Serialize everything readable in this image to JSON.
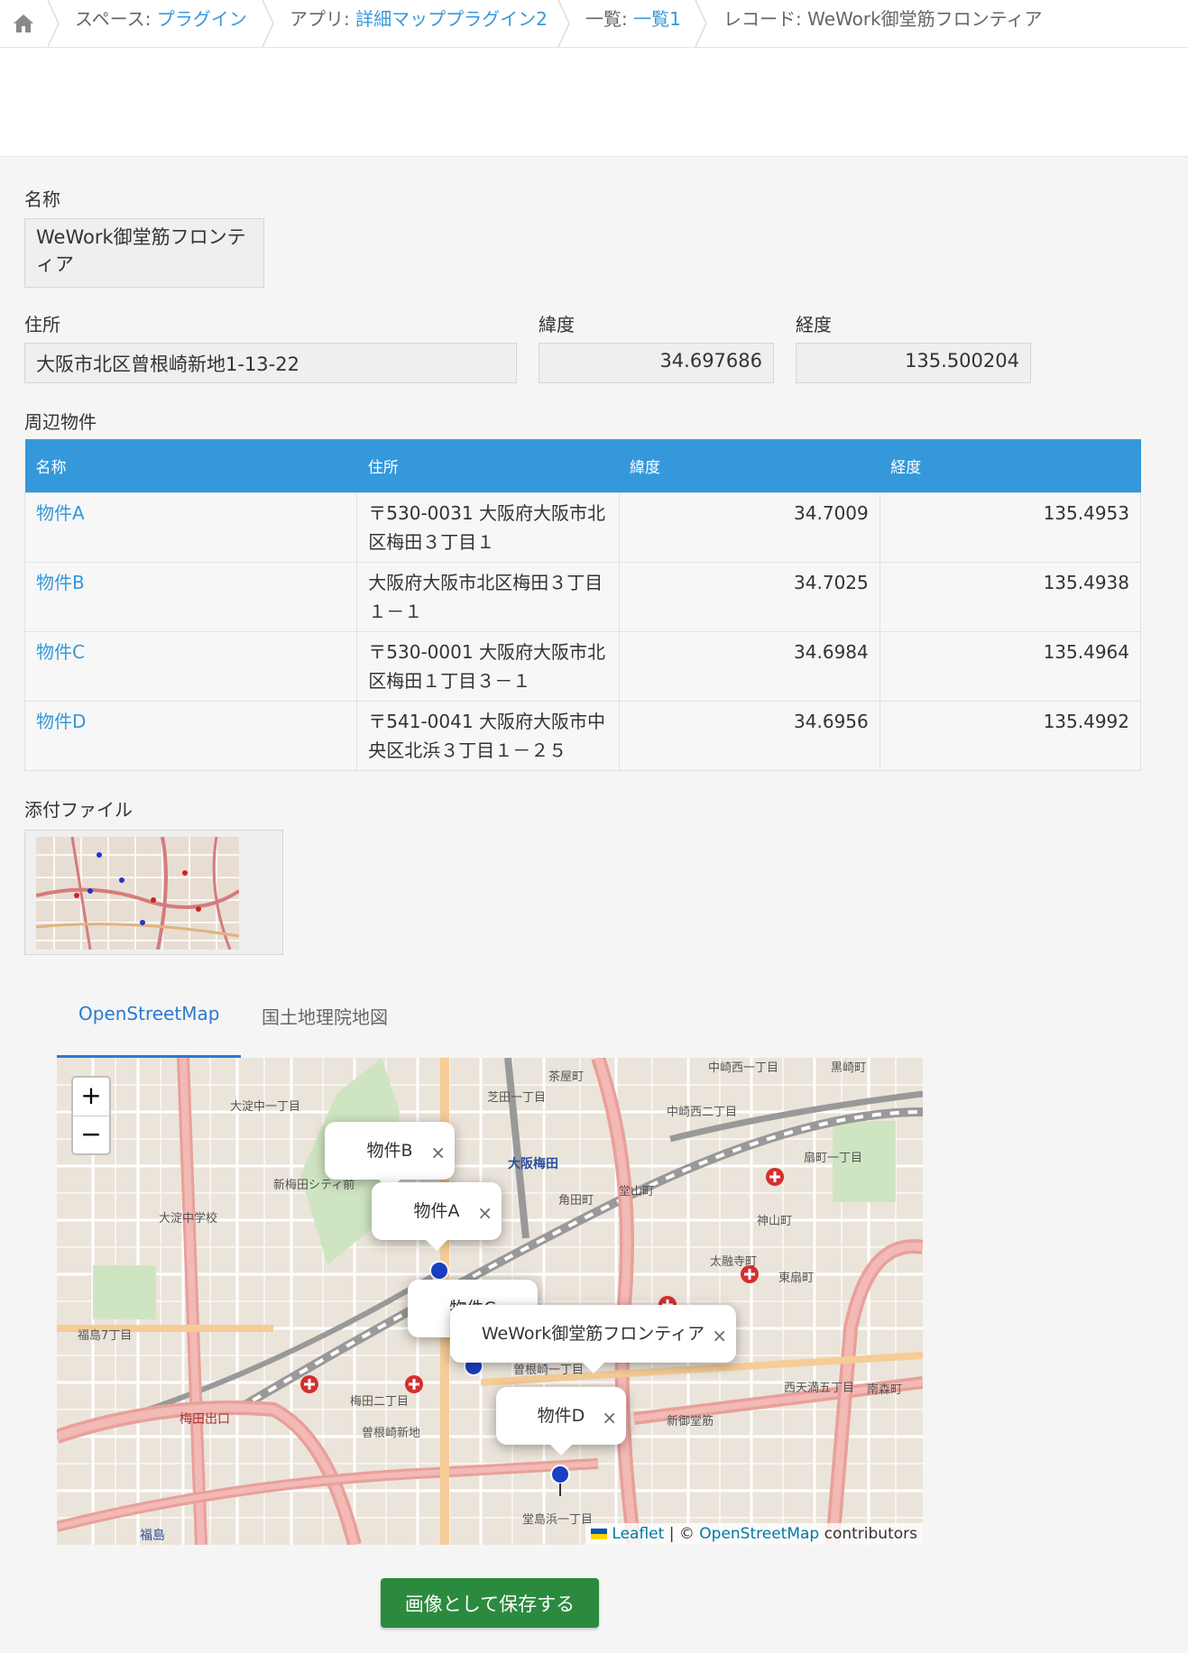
{
  "breadcrumb": {
    "space_prefix": "スペース: ",
    "space_link": "プラグイン",
    "app_prefix": "アプリ: ",
    "app_link": "詳細マッププラグイン2",
    "view_prefix": "一覧: ",
    "view_link": "一覧1",
    "record": "レコード: WeWork御堂筋フロンティア"
  },
  "fields": {
    "name_label": "名称",
    "name_value": "WeWork御堂筋フロンティア",
    "address_label": "住所",
    "address_value": "大阪市北区曾根崎新地1-13-22",
    "lat_label": "緯度",
    "lat_value": "34.697686",
    "lng_label": "経度",
    "lng_value": "135.500204"
  },
  "subtable": {
    "label": "周辺物件",
    "headers": [
      "名称",
      "住所",
      "緯度",
      "経度"
    ],
    "rows": [
      {
        "name": "物件A",
        "address": "〒530-0031 大阪府大阪市北区梅田３丁目１",
        "lat": "34.7009",
        "lng": "135.4953"
      },
      {
        "name": "物件B",
        "address": "大阪府大阪市北区梅田３丁目１－１",
        "lat": "34.7025",
        "lng": "135.4938"
      },
      {
        "name": "物件C",
        "address": "〒530-0001 大阪府大阪市北区梅田１丁目３－１",
        "lat": "34.6984",
        "lng": "135.4964"
      },
      {
        "name": "物件D",
        "address": "〒541-0041 大阪府大阪市中央区北浜３丁目１－２５",
        "lat": "34.6956",
        "lng": "135.4992"
      }
    ]
  },
  "attachment": {
    "label": "添付ファイル"
  },
  "map": {
    "tabs": [
      "OpenStreetMap",
      "国土地理院地図"
    ],
    "active_tab": 0,
    "zoom_in": "+",
    "zoom_out": "−",
    "popups": [
      "物件B",
      "物件A",
      "物件C",
      "WeWork御堂筋フロンティア",
      "物件D"
    ],
    "close_glyph": "×",
    "attribution_leaflet": "Leaflet",
    "attribution_sep": " | © ",
    "attribution_osm": "OpenStreetMap",
    "attribution_tail": " contributors",
    "place_labels": [
      "茶屋町",
      "中崎西一丁目",
      "黒崎町",
      "芝田一丁目",
      "大阪梅田",
      "角田町",
      "堂山町",
      "中崎西二丁目",
      "扇町一丁目",
      "神山町",
      "大淀中一丁目",
      "新梅田シティ前",
      "大淀中学校",
      "福島7丁目",
      "梅田二丁目",
      "曽根崎新地",
      "曽根崎一丁目",
      "西天満五丁目",
      "南森町",
      "堂島浜一丁目",
      "福島",
      "梅田出口",
      "新御堂筋",
      "太融寺町",
      "東扇町"
    ]
  },
  "save_button": "画像として保存する",
  "colors": {
    "accent": "#3498db",
    "save": "#2b8a3e",
    "road_major": "#e8a09a",
    "road_minor": "#f6cc97"
  }
}
